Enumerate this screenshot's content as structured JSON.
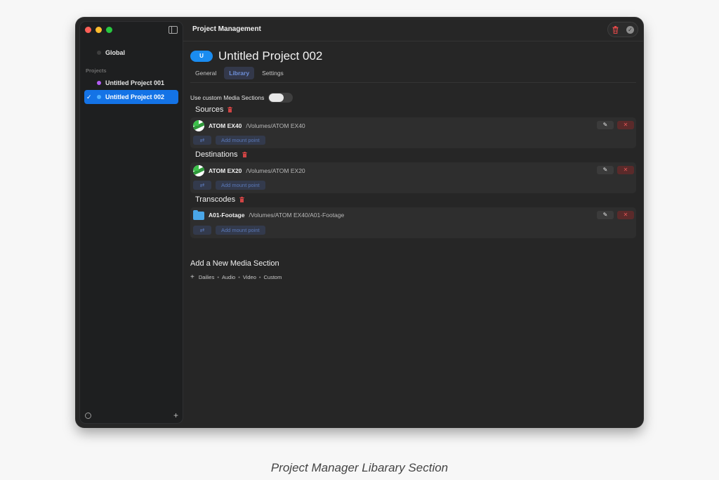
{
  "window": {
    "title": "Project Management"
  },
  "sidebar": {
    "global_label": "Global",
    "section_label": "Projects",
    "projects": [
      {
        "label": "Untitled Project 001",
        "color": "#b45cf5",
        "selected": false
      },
      {
        "label": "Untitled Project 002",
        "color": "#4fb0ff",
        "selected": true
      }
    ],
    "selected_check": "✓",
    "add_symbol": "+"
  },
  "project": {
    "badge": "U",
    "title": "Untitled Project 002",
    "tabs": [
      "General",
      "Library",
      "Settings"
    ],
    "active_tab": "Library"
  },
  "custom_sections": {
    "label": "Use custom Media Sections",
    "enabled": false
  },
  "sections": [
    {
      "title": "Sources",
      "item_name": "ATOM EX40",
      "item_path": "/Volumes/ATOM EX40",
      "icon": "drive-icon",
      "mount_label": "Add mount point"
    },
    {
      "title": "Destinations",
      "item_name": "ATOM EX20",
      "item_path": "/Volumes/ATOM EX20",
      "icon": "drive-icon",
      "mount_label": "Add mount point"
    },
    {
      "title": "Transcodes",
      "item_name": "A01-Footage",
      "item_path": "/Volumes/ATOM EX40/A01-Footage",
      "icon": "folder-icon",
      "mount_label": "Add mount point"
    }
  ],
  "add_section": {
    "title": "Add a New Media Section",
    "plus": "+",
    "options": [
      "Dailies",
      "Audio",
      "Video",
      "Custom"
    ],
    "separator": "•"
  },
  "icons": {
    "edit": "✎",
    "delete": "✕",
    "swap": "⇄",
    "check": "✓"
  },
  "colors": {
    "accent": "#1473e6",
    "danger": "#e05555",
    "background": "#262626"
  },
  "caption": "Project Manager Libarary Section"
}
